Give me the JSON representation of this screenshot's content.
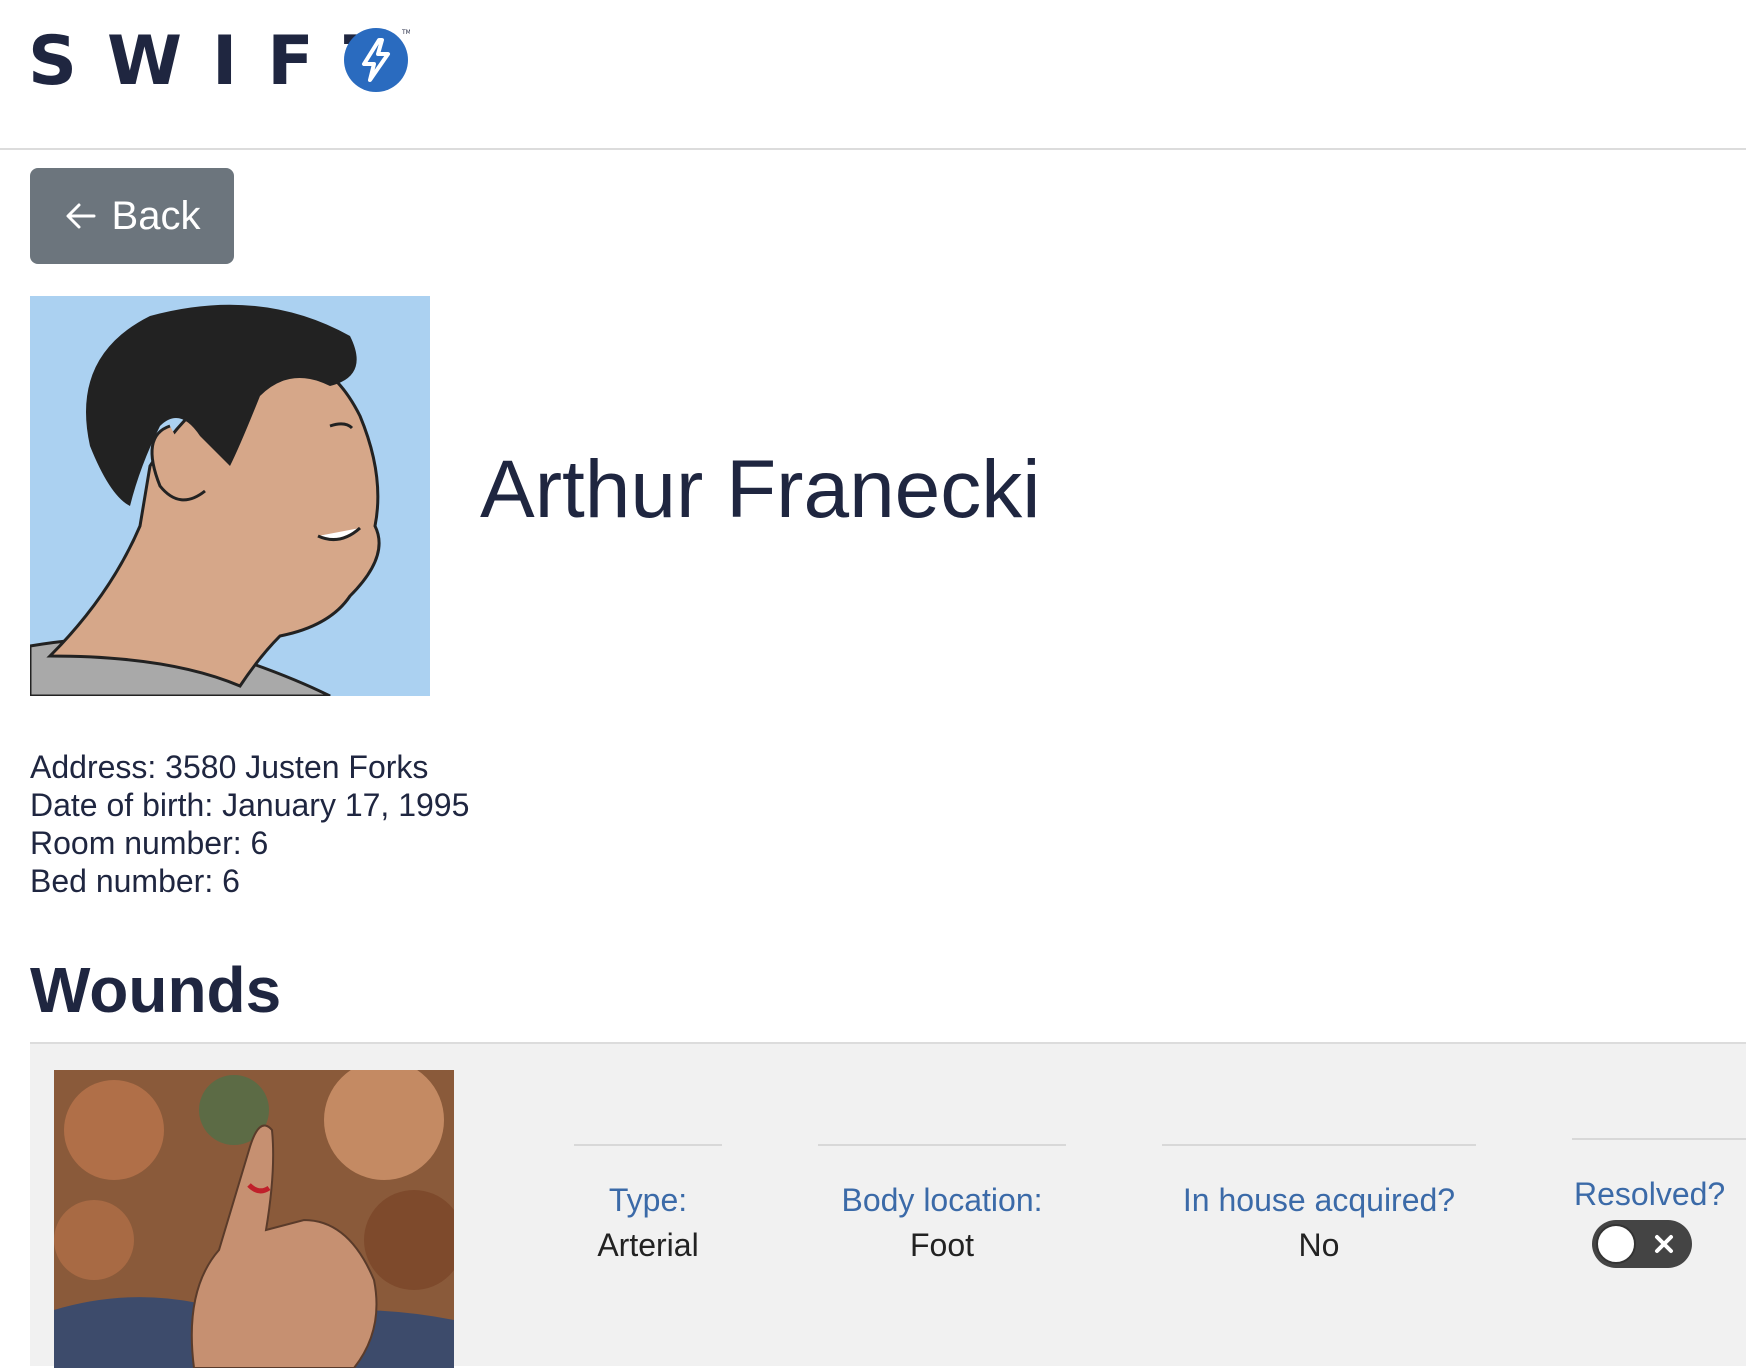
{
  "header": {
    "logo_text": "SWIFT",
    "logo_icon": "bolt-icon",
    "brand_color": "#2a6bbf"
  },
  "back_button": {
    "label": "Back",
    "icon": "arrow-left-icon"
  },
  "patient": {
    "name": "Arthur Franecki",
    "details": [
      "Address: 3580 Justen Forks",
      "Date of birth: January 17, 1995",
      "Room number: 6",
      "Bed number: 6"
    ]
  },
  "wounds": {
    "title": "Wounds",
    "items": [
      {
        "fields": [
          {
            "label": "Type:",
            "value": "Arterial"
          },
          {
            "label": "Body location:",
            "value": "Foot"
          },
          {
            "label": "In house acquired?",
            "value": "No"
          }
        ],
        "resolved": {
          "label": "Resolved?",
          "state": "off"
        }
      }
    ]
  }
}
